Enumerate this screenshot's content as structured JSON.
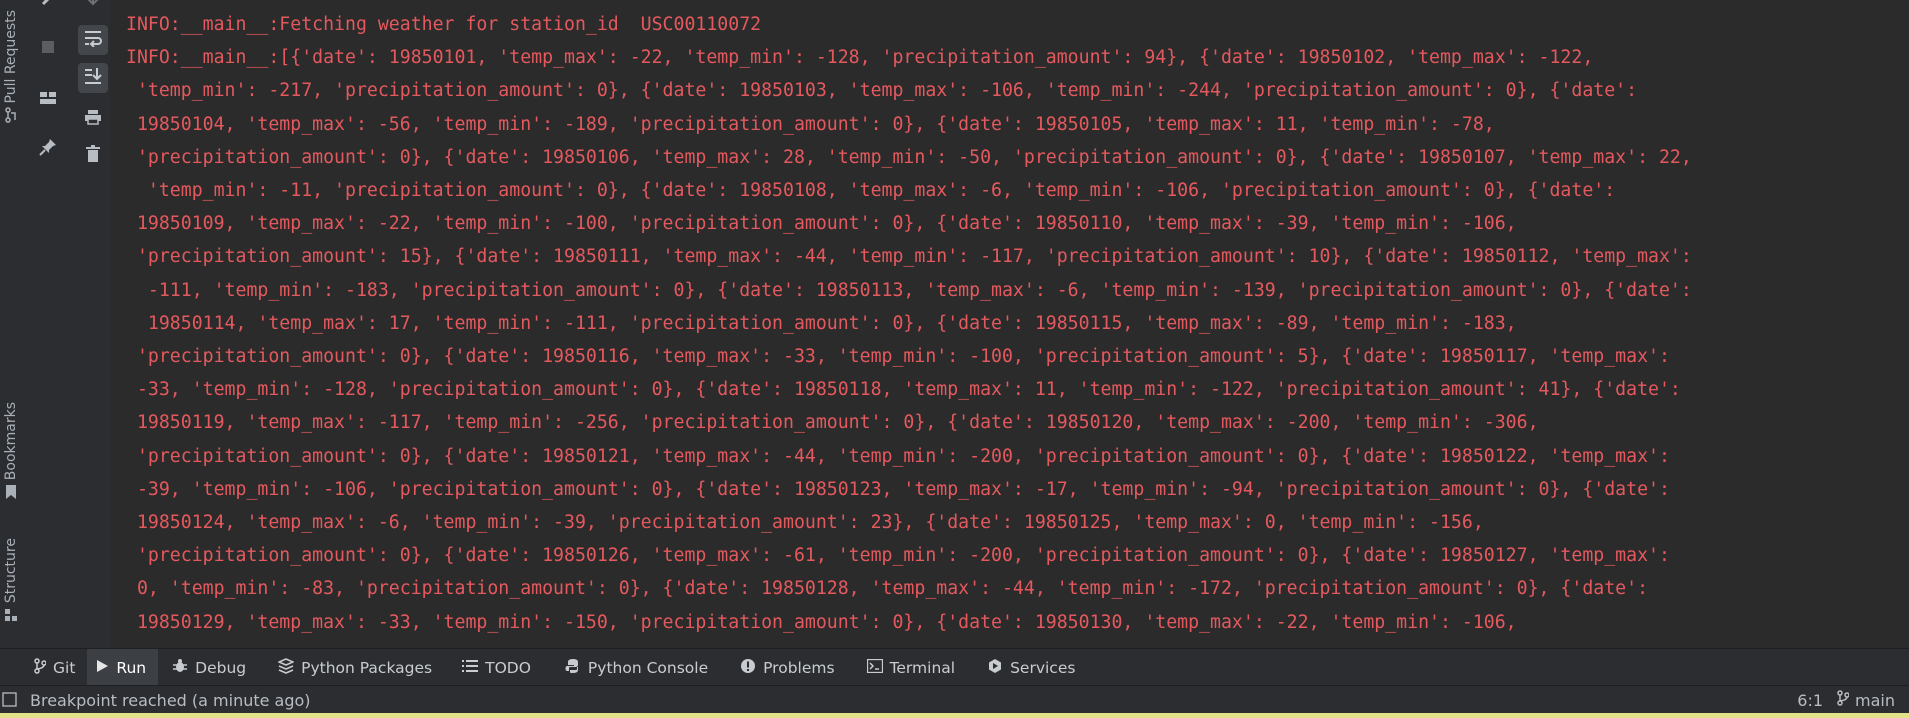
{
  "left_strip": {
    "tabs": [
      {
        "label": "Pull Requests",
        "icon": "pull-request-icon"
      },
      {
        "label": "Bookmarks",
        "icon": "bookmark-icon"
      },
      {
        "label": "Structure",
        "icon": "structure-icon"
      }
    ]
  },
  "run_toolbar": {
    "icons": [
      "wrench-icon",
      "stop-icon",
      "layout-icon",
      "pin-icon",
      "down-arrow-icon",
      "soft-wrap-icon",
      "scroll-to-end-icon",
      "print-icon",
      "trash-icon"
    ]
  },
  "console": {
    "lines": [
      "INFO:__main__:Fetching weather for station_id  USC00110072",
      "INFO:__main__:[{'date': 19850101, 'temp_max': -22, 'temp_min': -128, 'precipitation_amount': 94}, {'date': 19850102, 'temp_max': -122,",
      " 'temp_min': -217, 'precipitation_amount': 0}, {'date': 19850103, 'temp_max': -106, 'temp_min': -244, 'precipitation_amount': 0}, {'date':",
      " 19850104, 'temp_max': -56, 'temp_min': -189, 'precipitation_amount': 0}, {'date': 19850105, 'temp_max': 11, 'temp_min': -78,",
      " 'precipitation_amount': 0}, {'date': 19850106, 'temp_max': 28, 'temp_min': -50, 'precipitation_amount': 0}, {'date': 19850107, 'temp_max': 22,",
      "  'temp_min': -11, 'precipitation_amount': 0}, {'date': 19850108, 'temp_max': -6, 'temp_min': -106, 'precipitation_amount': 0}, {'date':",
      " 19850109, 'temp_max': -22, 'temp_min': -100, 'precipitation_amount': 0}, {'date': 19850110, 'temp_max': -39, 'temp_min': -106,",
      " 'precipitation_amount': 15}, {'date': 19850111, 'temp_max': -44, 'temp_min': -117, 'precipitation_amount': 10}, {'date': 19850112, 'temp_max':",
      "  -111, 'temp_min': -183, 'precipitation_amount': 0}, {'date': 19850113, 'temp_max': -6, 'temp_min': -139, 'precipitation_amount': 0}, {'date':",
      "  19850114, 'temp_max': 17, 'temp_min': -111, 'precipitation_amount': 0}, {'date': 19850115, 'temp_max': -89, 'temp_min': -183,",
      " 'precipitation_amount': 0}, {'date': 19850116, 'temp_max': -33, 'temp_min': -100, 'precipitation_amount': 5}, {'date': 19850117, 'temp_max':",
      " -33, 'temp_min': -128, 'precipitation_amount': 0}, {'date': 19850118, 'temp_max': 11, 'temp_min': -122, 'precipitation_amount': 41}, {'date':",
      " 19850119, 'temp_max': -117, 'temp_min': -256, 'precipitation_amount': 0}, {'date': 19850120, 'temp_max': -200, 'temp_min': -306,",
      " 'precipitation_amount': 0}, {'date': 19850121, 'temp_max': -44, 'temp_min': -200, 'precipitation_amount': 0}, {'date': 19850122, 'temp_max':",
      " -39, 'temp_min': -106, 'precipitation_amount': 0}, {'date': 19850123, 'temp_max': -17, 'temp_min': -94, 'precipitation_amount': 0}, {'date':",
      " 19850124, 'temp_max': -6, 'temp_min': -39, 'precipitation_amount': 23}, {'date': 19850125, 'temp_max': 0, 'temp_min': -156,",
      " 'precipitation_amount': 0}, {'date': 19850126, 'temp_max': -61, 'temp_min': -200, 'precipitation_amount': 0}, {'date': 19850127, 'temp_max':",
      " 0, 'temp_min': -83, 'precipitation_amount': 0}, {'date': 19850128, 'temp_max': -44, 'temp_min': -172, 'precipitation_amount': 0}, {'date':",
      " 19850129, 'temp_max': -33, 'temp_min': -150, 'precipitation_amount': 0}, {'date': 19850130, 'temp_max': -22, 'temp_min': -106,"
    ],
    "text_color": "#e4595e"
  },
  "tool_windows": [
    {
      "label": "Git",
      "icon": "git-branch-icon",
      "active": false
    },
    {
      "label": "Run",
      "icon": "run-icon",
      "active": true
    },
    {
      "label": "Debug",
      "icon": "debug-icon",
      "active": false
    },
    {
      "label": "Python Packages",
      "icon": "packages-icon",
      "active": false
    },
    {
      "label": "TODO",
      "icon": "todo-icon",
      "active": false
    },
    {
      "label": "Python Console",
      "icon": "python-console-icon",
      "active": false
    },
    {
      "label": "Problems",
      "icon": "problems-icon",
      "active": false
    },
    {
      "label": "Terminal",
      "icon": "terminal-icon",
      "active": false
    },
    {
      "label": "Services",
      "icon": "services-icon",
      "active": false
    }
  ],
  "status_bar": {
    "message": "Breakpoint reached (a minute ago)",
    "position": "6:1",
    "branch": "main"
  }
}
